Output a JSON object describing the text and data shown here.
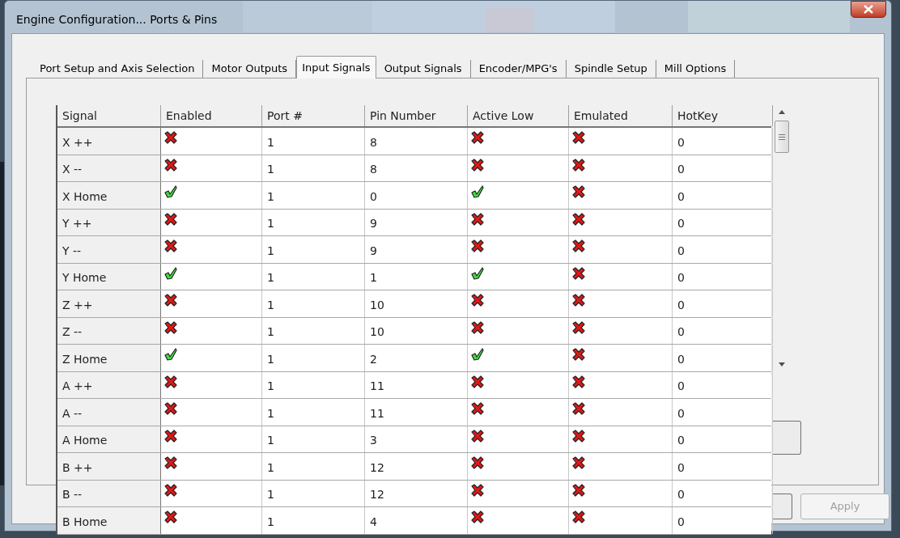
{
  "window": {
    "title": "Engine Configuration... Ports & Pins"
  },
  "tabs": [
    {
      "label": "Port Setup and Axis Selection",
      "selected": false
    },
    {
      "label": "Motor Outputs",
      "selected": false
    },
    {
      "label": "Input Signals",
      "selected": true
    },
    {
      "label": "Output Signals",
      "selected": false
    },
    {
      "label": "Encoder/MPG's",
      "selected": false
    },
    {
      "label": "Spindle Setup",
      "selected": false
    },
    {
      "label": "Mill Options",
      "selected": false
    }
  ],
  "table": {
    "columns": [
      "Signal",
      "Enabled",
      "Port #",
      "Pin Number",
      "Active Low",
      "Emulated",
      "HotKey"
    ],
    "rows": [
      {
        "signal": "X ++",
        "enabled": false,
        "port": "1",
        "pin": "8",
        "active_low": false,
        "emulated": false,
        "hotkey": "0"
      },
      {
        "signal": "X --",
        "enabled": false,
        "port": "1",
        "pin": "8",
        "active_low": false,
        "emulated": false,
        "hotkey": "0"
      },
      {
        "signal": "X Home",
        "enabled": true,
        "port": "1",
        "pin": "0",
        "active_low": true,
        "emulated": false,
        "hotkey": "0"
      },
      {
        "signal": "Y ++",
        "enabled": false,
        "port": "1",
        "pin": "9",
        "active_low": false,
        "emulated": false,
        "hotkey": "0"
      },
      {
        "signal": "Y --",
        "enabled": false,
        "port": "1",
        "pin": "9",
        "active_low": false,
        "emulated": false,
        "hotkey": "0"
      },
      {
        "signal": "Y Home",
        "enabled": true,
        "port": "1",
        "pin": "1",
        "active_low": true,
        "emulated": false,
        "hotkey": "0"
      },
      {
        "signal": "Z ++",
        "enabled": false,
        "port": "1",
        "pin": "10",
        "active_low": false,
        "emulated": false,
        "hotkey": "0"
      },
      {
        "signal": "Z --",
        "enabled": false,
        "port": "1",
        "pin": "10",
        "active_low": false,
        "emulated": false,
        "hotkey": "0"
      },
      {
        "signal": "Z Home",
        "enabled": true,
        "port": "1",
        "pin": "2",
        "active_low": true,
        "emulated": false,
        "hotkey": "0"
      },
      {
        "signal": "A ++",
        "enabled": false,
        "port": "1",
        "pin": "11",
        "active_low": false,
        "emulated": false,
        "hotkey": "0"
      },
      {
        "signal": "A --",
        "enabled": false,
        "port": "1",
        "pin": "11",
        "active_low": false,
        "emulated": false,
        "hotkey": "0"
      },
      {
        "signal": "A Home",
        "enabled": false,
        "port": "1",
        "pin": "3",
        "active_low": false,
        "emulated": false,
        "hotkey": "0"
      },
      {
        "signal": "B ++",
        "enabled": false,
        "port": "1",
        "pin": "12",
        "active_low": false,
        "emulated": false,
        "hotkey": "0"
      },
      {
        "signal": "B --",
        "enabled": false,
        "port": "1",
        "pin": "12",
        "active_low": false,
        "emulated": false,
        "hotkey": "0"
      },
      {
        "signal": "B Home",
        "enabled": false,
        "port": "1",
        "pin": "4",
        "active_low": false,
        "emulated": false,
        "hotkey": "0"
      }
    ]
  },
  "buttons": [
    {
      "label": "Apply",
      "disabled": true
    }
  ]
}
